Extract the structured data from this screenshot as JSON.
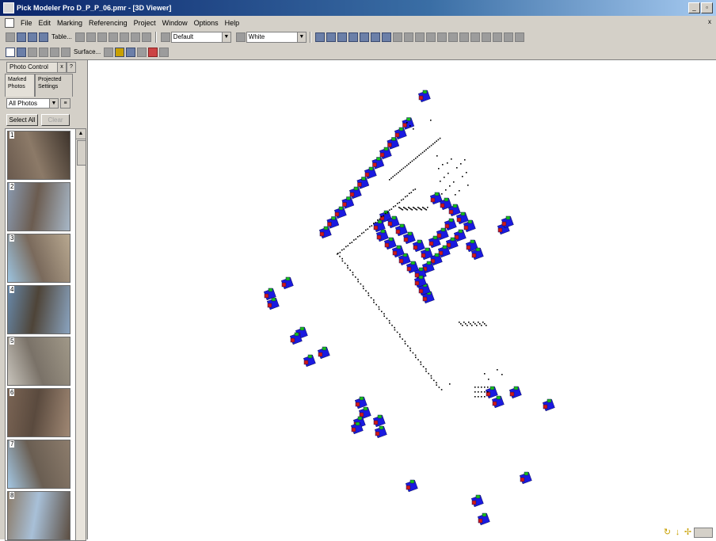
{
  "window": {
    "title": "Pick Modeler Pro D_P_P_06.pmr - [3D Viewer]",
    "buttons": [
      "_",
      "▫",
      "x"
    ]
  },
  "menubar": {
    "items": [
      "File",
      "Edit",
      "Marking",
      "Referencing",
      "Project",
      "Window",
      "Options",
      "Help"
    ]
  },
  "toolbar1": {
    "table_label": "Table...",
    "default_combo": "Default",
    "color_combo": "White"
  },
  "toolbar2": {
    "surface_label": "Surface..."
  },
  "sidebar": {
    "panel_title": "Photo Control",
    "tabs": [
      "Marked Photos",
      "Projected Settings"
    ],
    "filter_value": "All Photos",
    "select_all_label": "Select All",
    "clear_label": "Clear",
    "photos": [
      {
        "num": "1",
        "palette": [
          "#6a5a4e",
          "#8c7a68",
          "#3e342c"
        ]
      },
      {
        "num": "2",
        "palette": [
          "#8a9ab0",
          "#6b5c50",
          "#a8b8c8"
        ]
      },
      {
        "num": "3",
        "palette": [
          "#9cc4e0",
          "#7a6a5c",
          "#b8a890"
        ]
      },
      {
        "num": "4",
        "palette": [
          "#6888a8",
          "#4e4438",
          "#8aa4c0"
        ]
      },
      {
        "num": "5",
        "palette": [
          "#c8c4bc",
          "#7a7268",
          "#a09888"
        ]
      },
      {
        "num": "6",
        "palette": [
          "#7a6454",
          "#5a4a3e",
          "#a08874"
        ]
      },
      {
        "num": "7",
        "palette": [
          "#a4c8e4",
          "#6a5e52",
          "#8c7c6c"
        ]
      },
      {
        "num": "8",
        "palette": [
          "#8c7c6a",
          "#a8c0d8",
          "#5c4e42"
        ]
      }
    ]
  },
  "viewer": {
    "background": "#ffffff",
    "camera_colors": {
      "blue": "#1a1ae0",
      "red": "#d01818",
      "green": "#18c018"
    }
  }
}
